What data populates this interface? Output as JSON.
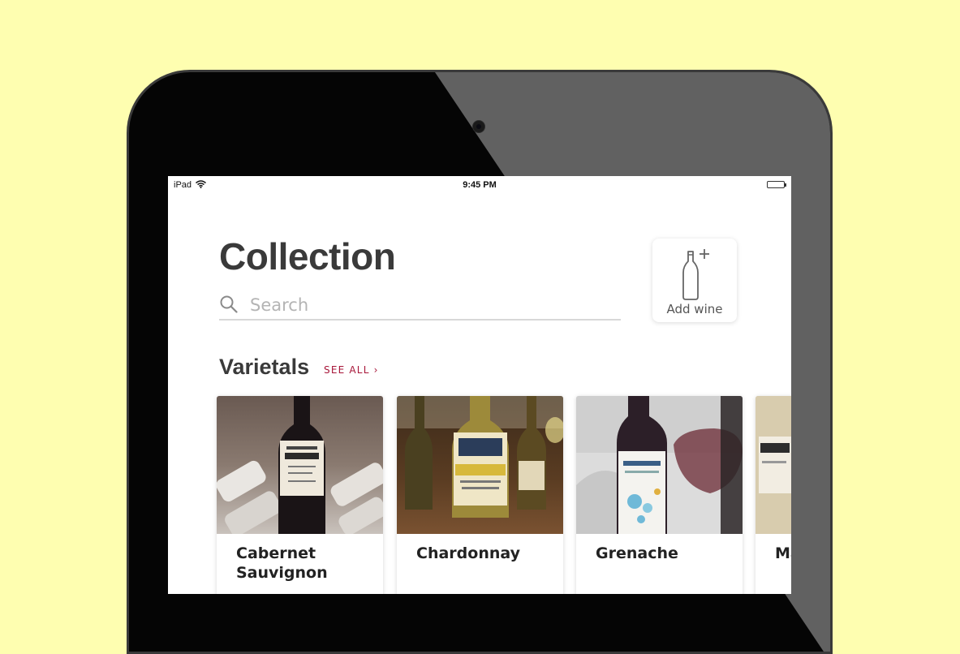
{
  "device": {
    "model_label": "iPad"
  },
  "status_bar": {
    "carrier": "iPad",
    "time": "9:45 PM"
  },
  "header": {
    "title": "Collection",
    "add_wine_label": "Add wine"
  },
  "search": {
    "placeholder": "Search",
    "value": ""
  },
  "varietals": {
    "title": "Varietals",
    "see_all_label": "SEE ALL",
    "items": [
      {
        "name": "Cabernet Sauvignon"
      },
      {
        "name": "Chardonnay"
      },
      {
        "name": "Grenache"
      },
      {
        "name": "Ma"
      }
    ]
  },
  "colors": {
    "background": "#fefeb0",
    "accent": "#a8173a",
    "title_text": "#3a3a3a"
  }
}
